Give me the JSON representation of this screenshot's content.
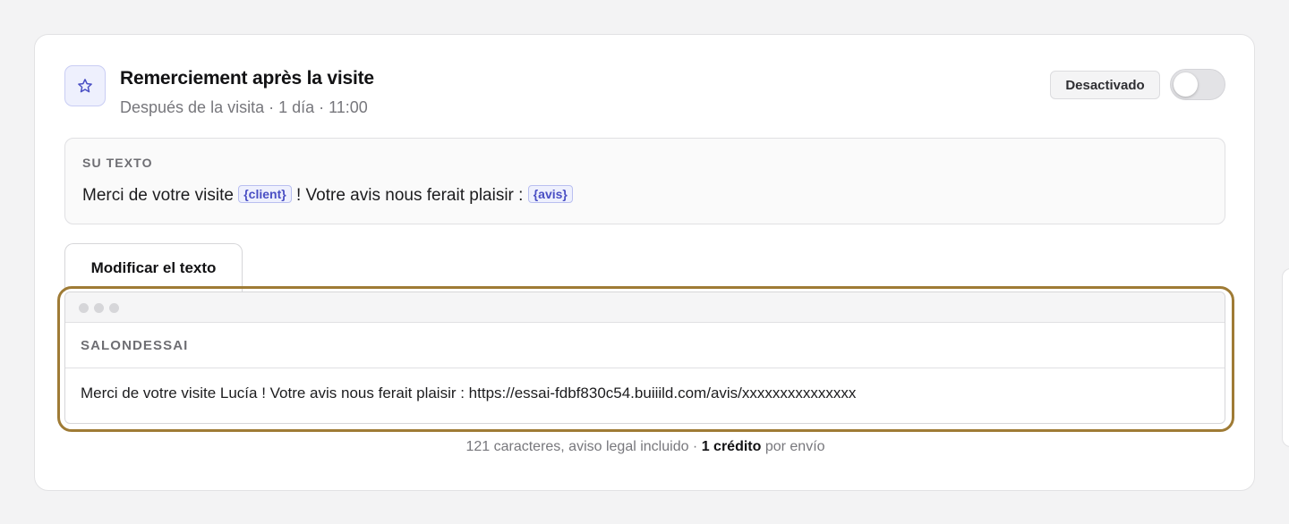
{
  "automation": {
    "icon": "star-icon",
    "title": "Remerciement après la visite",
    "subtitle": "Después de la visita · 1 día · 11:00",
    "status_label": "Desactivado",
    "enabled": false
  },
  "your_text": {
    "label": "SU TEXTO",
    "segments": {
      "part1": "Merci de votre visite ",
      "var1": "{client}",
      "part2": " ! Votre avis nous ferait plaisir : ",
      "var2": "{avis}"
    }
  },
  "edit_button": {
    "label": "Modificar el texto"
  },
  "preview": {
    "sender": "SALONDESSAI",
    "message": "Merci de votre visite Lucía ! Votre avis nous ferait plaisir : https://essai-fdbf830c54.buiiild.com/avis/xxxxxxxxxxxxxxx"
  },
  "footer": {
    "chars_text": "121 caracteres, aviso legal incluido · ",
    "credit_text": "1 crédito",
    "per_send_text": " por envío"
  },
  "colors": {
    "accent": "#4a4fc4",
    "highlight": "#9f7b35"
  }
}
